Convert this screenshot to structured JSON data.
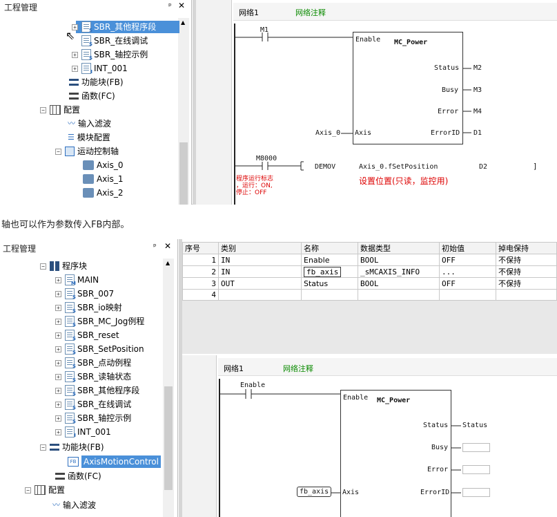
{
  "top": {
    "panel_title": "工程管理",
    "pin": "ᵖ",
    "close": "✕",
    "tree": [
      "SBR_其他程序段",
      "SBR_在线调试",
      "SBR_轴控示例",
      "INT_001",
      "功能块(FB)",
      "函数(FC)",
      "配置",
      "输入滤波",
      "模块配置",
      "运动控制轴",
      "Axis_0",
      "Axis_1",
      "Axis_2"
    ],
    "network": "网络1",
    "network_comment": "网络注释",
    "contact1": "M1",
    "fb_enable": "Enable",
    "fb_name": "MC_Power",
    "outputs": [
      "Status",
      "Busy",
      "Error",
      "ErrorID"
    ],
    "output_vars": [
      "M2",
      "M3",
      "M4",
      "D1"
    ],
    "axis_in_var": "Axis_0",
    "axis_in": "Axis",
    "contact2": "M8000",
    "instr": "DEMOV",
    "instr_arg1": "Axis_0.fSetPosition",
    "instr_arg2": "D2",
    "contact2_comment": [
      "程序运行标志",
      "，运行：ON,",
      "停止：OFF"
    ],
    "instr_comment": "设置位置(只读，监控用)"
  },
  "caption": "轴也可以作为参数传入FB内部。",
  "bottom": {
    "panel_title": "工程管理",
    "pin": "ᵖ",
    "close": "✕",
    "tree": [
      "程序块",
      "MAIN",
      "SBR_007",
      "SBR_io映射",
      "SBR_MC_Jog例程",
      "SBR_reset",
      "SBR_SetPosition",
      "SBR_点动例程",
      "SBR_读轴状态",
      "SBR_其他程序段",
      "SBR_在线调试",
      "SBR_轴控示例",
      "INT_001",
      "功能块(FB)",
      "AxisMotionControl",
      "函数(FC)",
      "配置",
      "输入滤波"
    ],
    "table": {
      "headers": [
        "序号",
        "类别",
        "名称",
        "数据类型",
        "初始值",
        "掉电保持"
      ],
      "rows": [
        [
          "1",
          "IN",
          "Enable",
          "BOOL",
          "OFF",
          "不保持"
        ],
        [
          "2",
          "IN",
          "fb_axis",
          "_sMCAXIS_INFO",
          "...",
          "不保持"
        ],
        [
          "3",
          "OUT",
          "Status",
          "BOOL",
          "OFF",
          "不保持"
        ],
        [
          "4",
          "",
          "",
          "",
          "",
          ""
        ]
      ]
    },
    "network": "网络1",
    "network_comment": "网络注释",
    "contact1": "Enable",
    "fb_enable": "Enable",
    "fb_name": "MC_Power",
    "outputs": [
      "Status",
      "Busy",
      "Error",
      "ErrorID"
    ],
    "status_var": "Status",
    "axis_in_var": "fb_axis",
    "axis_in": "Axis"
  }
}
